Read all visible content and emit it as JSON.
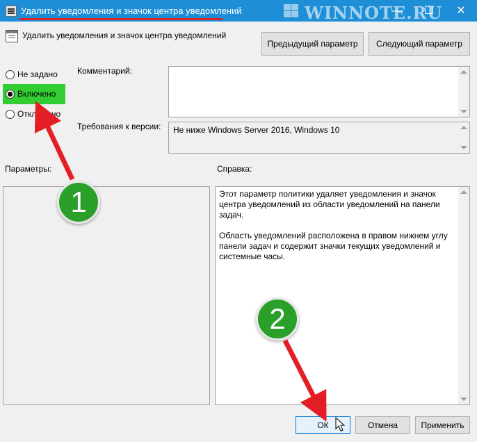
{
  "window": {
    "title": "Удалить уведомления и значок центра уведомлений",
    "watermark": "WINNOTE.RU",
    "controls": {
      "minimize": "—",
      "maximize": "☐",
      "close": "✕"
    }
  },
  "header": {
    "title": "Удалить уведомления и значок центра уведомлений",
    "prev_button": "Предыдущий параметр",
    "next_button": "Следующий параметр"
  },
  "state": {
    "options": [
      {
        "label": "Не задано",
        "checked": false
      },
      {
        "label": "Включено",
        "checked": true
      },
      {
        "label": "Отключено",
        "checked": false
      }
    ]
  },
  "comment": {
    "label": "Комментарий:",
    "value": ""
  },
  "supported": {
    "label": "Требования к версии:",
    "value": "Не ниже Windows Server 2016, Windows 10"
  },
  "options_panel": {
    "label": "Параметры:"
  },
  "help_panel": {
    "label": "Справка:",
    "paragraph1": "Этот параметр политики удаляет уведомления и значок центра уведомлений из области уведомлений на панели задач.",
    "paragraph2": "Область уведомлений расположена в правом нижнем углу панели задач и содержит значки текущих уведомлений и системные часы."
  },
  "footer": {
    "ok": "ОК",
    "cancel": "Отмена",
    "apply": "Применить"
  },
  "annotations": {
    "step1": "1",
    "step2": "2",
    "badge_color": "#2aa02a",
    "arrow_color": "#e31e24"
  }
}
